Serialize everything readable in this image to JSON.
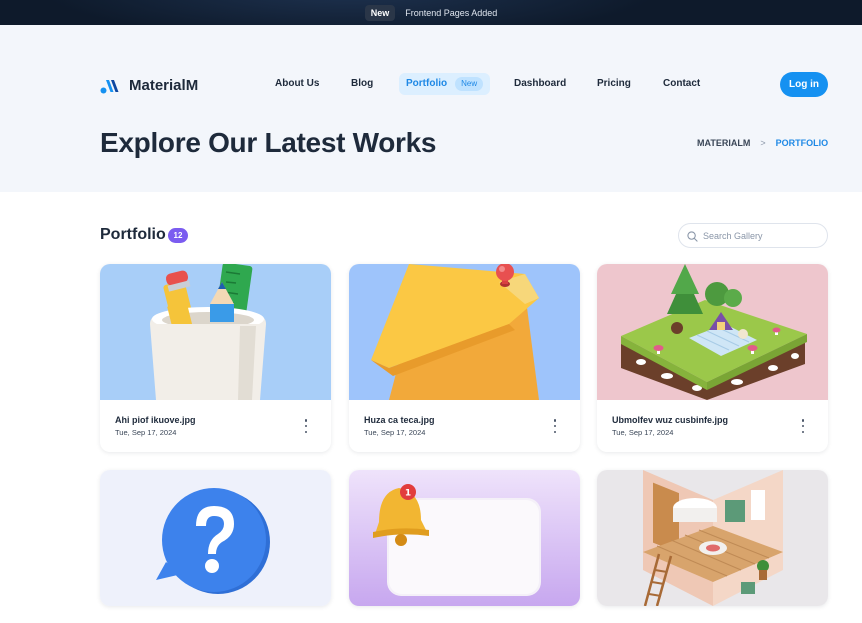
{
  "announcement": {
    "badge": "New",
    "message": "Frontend Pages Added"
  },
  "brand": {
    "name": "MaterialM",
    "accent": "#1591f1"
  },
  "nav": {
    "items": [
      {
        "label": "About Us"
      },
      {
        "label": "Blog"
      },
      {
        "label": "Portfolio",
        "badge": "New",
        "active": true
      },
      {
        "label": "Dashboard"
      },
      {
        "label": "Pricing"
      },
      {
        "label": "Contact"
      }
    ],
    "login_label": "Log in"
  },
  "hero": {
    "title": "Explore Our Latest Works",
    "breadcrumb": [
      "MATERIALM",
      "PORTFOLIO"
    ],
    "breadcrumb_separator": ">"
  },
  "portfolio": {
    "title": "Portfolio",
    "count": "12",
    "count_color": "#7b5cf0",
    "search_placeholder": "Search Gallery",
    "items": [
      {
        "filename": "Ahi piof ikuove.jpg",
        "date": "Tue, Sep 17, 2024",
        "image": "pencil-cup-image"
      },
      {
        "filename": "Huza ca teca.jpg",
        "date": "Tue, Sep 17, 2024",
        "image": "sticky-note-image"
      },
      {
        "filename": "Ubmolfev wuz cusbinfe.jpg",
        "date": "Tue, Sep 17, 2024",
        "image": "picnic-island-image"
      },
      {
        "image": "question-bubble-image"
      },
      {
        "image": "notification-bell-image"
      },
      {
        "image": "isometric-room-image"
      }
    ]
  }
}
